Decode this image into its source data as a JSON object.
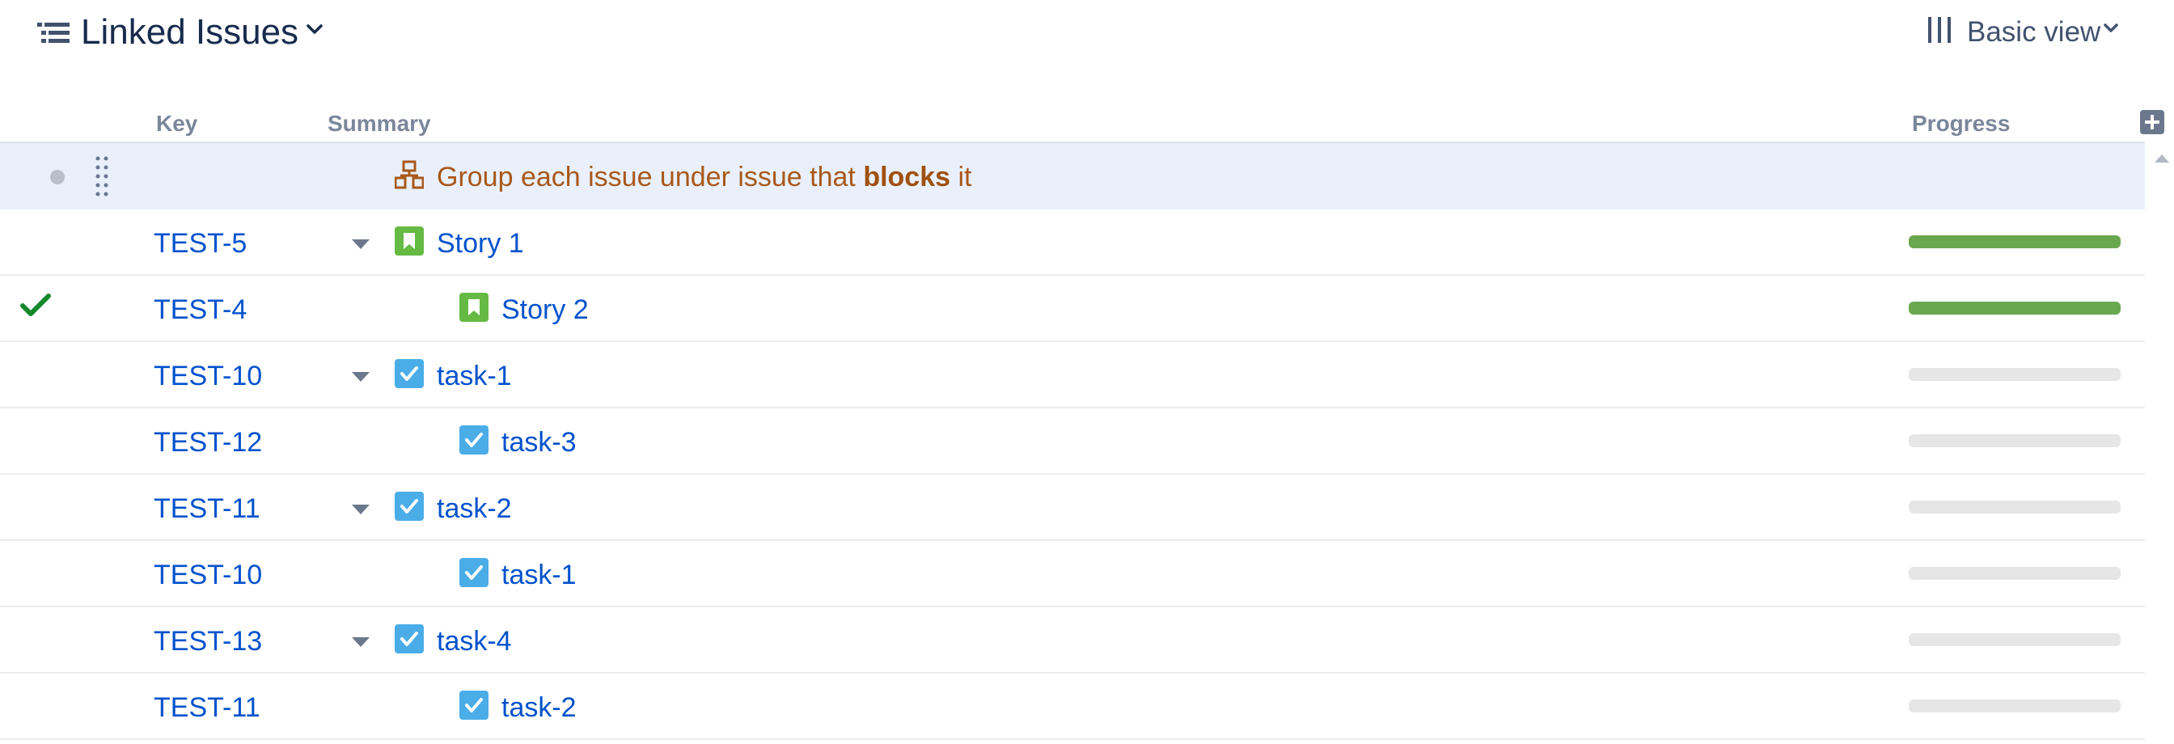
{
  "header": {
    "title": "Linked Issues",
    "view_label": "Basic view"
  },
  "columns": {
    "key": "Key",
    "summary": "Summary",
    "progress": "Progress"
  },
  "grouping": {
    "text_before": "Group each issue under issue that ",
    "text_bold": "blocks",
    "text_after": " it"
  },
  "rows": [
    {
      "key": "TEST-5",
      "summary": "Story 1",
      "type": "story",
      "expandable": true,
      "child": false,
      "progress": 1.0,
      "done": false
    },
    {
      "key": "TEST-4",
      "summary": "Story 2",
      "type": "story",
      "expandable": false,
      "child": true,
      "progress": 1.0,
      "done": true
    },
    {
      "key": "TEST-10",
      "summary": "task-1",
      "type": "task",
      "expandable": true,
      "child": false,
      "progress": 0.0,
      "done": false
    },
    {
      "key": "TEST-12",
      "summary": "task-3",
      "type": "task",
      "expandable": false,
      "child": true,
      "progress": 0.0,
      "done": false
    },
    {
      "key": "TEST-11",
      "summary": "task-2",
      "type": "task",
      "expandable": true,
      "child": false,
      "progress": 0.0,
      "done": false
    },
    {
      "key": "TEST-10",
      "summary": "task-1",
      "type": "task",
      "expandable": false,
      "child": true,
      "progress": 0.0,
      "done": false
    },
    {
      "key": "TEST-13",
      "summary": "task-4",
      "type": "task",
      "expandable": true,
      "child": false,
      "progress": 0.0,
      "done": false
    },
    {
      "key": "TEST-11",
      "summary": "task-2",
      "type": "task",
      "expandable": false,
      "child": true,
      "progress": 0.0,
      "done": false
    }
  ],
  "colors": {
    "story_icon": "#65ba43",
    "task_icon": "#4bade8",
    "progress_done": "#6aa84f",
    "progress_empty": "#e6e6e6",
    "check": "#14892c",
    "link": "#0052cc",
    "grouping_text": "#a9581a"
  },
  "icons": {
    "header": "structure-list-icon",
    "view": "columns-icon",
    "add_column": "plus-square-icon",
    "group": "hierarchy-icon",
    "story": "bookmark-icon",
    "task": "checkbox-icon",
    "done": "checkmark-icon",
    "expand": "caret-down-icon",
    "drag": "drag-handle-icon"
  }
}
